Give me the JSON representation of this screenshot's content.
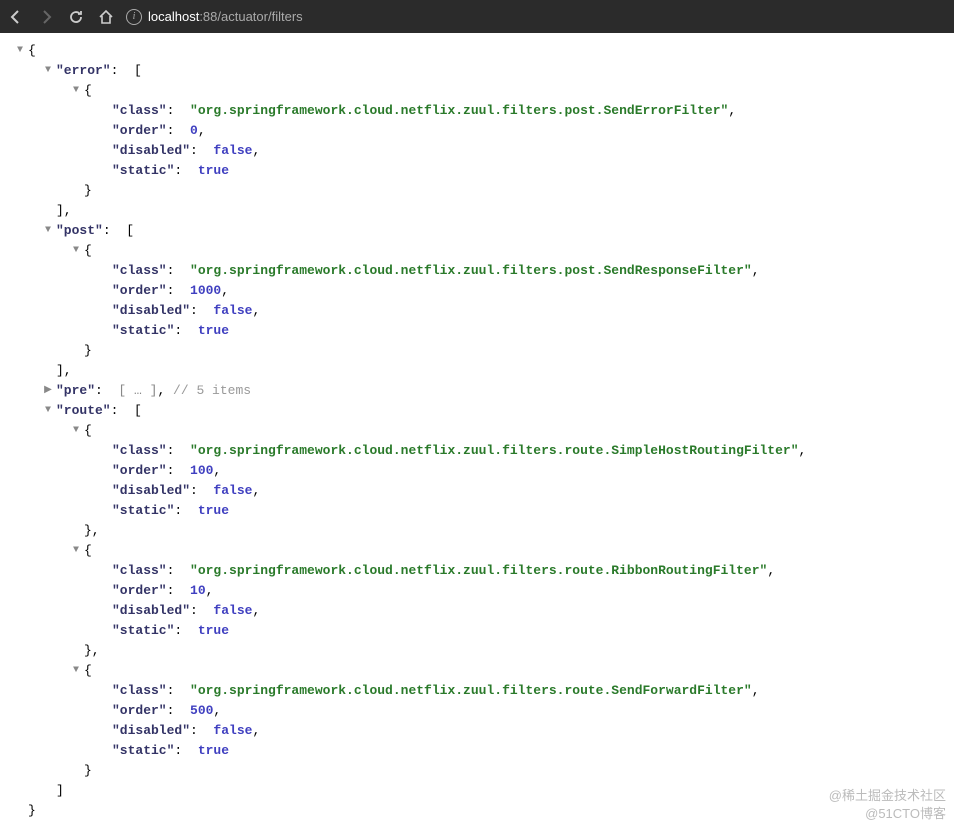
{
  "browser": {
    "url_host": "localhost",
    "url_port": ":88",
    "url_path": "/actuator/filters"
  },
  "json": {
    "error_key": "\"error\"",
    "post_key": "\"post\"",
    "pre_key": "\"pre\"",
    "route_key": "\"route\"",
    "class_key": "\"class\"",
    "order_key": "\"order\"",
    "disabled_key": "\"disabled\"",
    "static_key": "\"static\"",
    "error": {
      "class": "\"org.springframework.cloud.netflix.zuul.filters.post.SendErrorFilter\"",
      "order": "0",
      "disabled": "false",
      "static": "true"
    },
    "post": {
      "class": "\"org.springframework.cloud.netflix.zuul.filters.post.SendResponseFilter\"",
      "order": "1000",
      "disabled": "false",
      "static": "true"
    },
    "pre": {
      "collapsed": "[ … ]",
      "comment": "// 5 items"
    },
    "route": [
      {
        "class": "\"org.springframework.cloud.netflix.zuul.filters.route.SimpleHostRoutingFilter\"",
        "order": "100",
        "disabled": "false",
        "static": "true"
      },
      {
        "class": "\"org.springframework.cloud.netflix.zuul.filters.route.RibbonRoutingFilter\"",
        "order": "10",
        "disabled": "false",
        "static": "true"
      },
      {
        "class": "\"org.springframework.cloud.netflix.zuul.filters.route.SendForwardFilter\"",
        "order": "500",
        "disabled": "false",
        "static": "true"
      }
    ]
  },
  "watermark": {
    "line1": "@稀土掘金技术社区",
    "line2": "@51CTO博客"
  }
}
